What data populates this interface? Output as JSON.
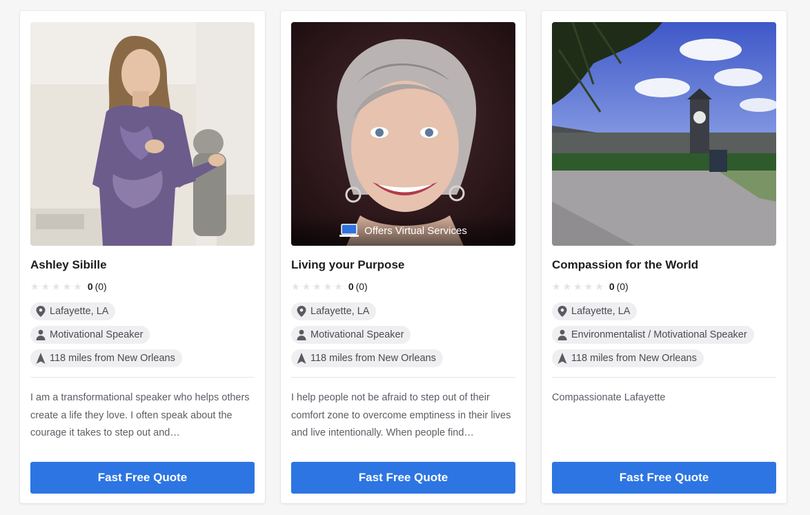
{
  "cards": [
    {
      "name": "Ashley Sibille",
      "rating_value": "0",
      "rating_count": "(0)",
      "location": "Lafayette, LA",
      "category": "Motivational Speaker",
      "distance": "118 miles from New Orleans",
      "description": "I am a transformational speaker who helps others create a life they love. I often speak about the courage it takes to step out and…",
      "button": "Fast Free Quote"
    },
    {
      "name": "Living your Purpose",
      "rating_value": "0",
      "rating_count": "(0)",
      "location": "Lafayette, LA",
      "category": "Motivational Speaker",
      "distance": "118 miles from New Orleans",
      "description": "I help people not be afraid to step out of their comfort zone to overcome emptiness in their lives and live intentionally. When people find…",
      "virtual_badge": "Offers Virtual Services",
      "button": "Fast Free Quote"
    },
    {
      "name": "Compassion for the World",
      "rating_value": "0",
      "rating_count": "(0)",
      "location": "Lafayette, LA",
      "category": "Environmentalist / Motivational Speaker",
      "distance": "118 miles from New Orleans",
      "description": "Compassionate Lafayette",
      "button": "Fast Free Quote"
    }
  ],
  "colors": {
    "button": "#2d75e2",
    "chip_bg": "#efeff1",
    "star_empty": "#e3e3e6"
  },
  "icons": [
    "map-pin-icon",
    "person-icon",
    "navigation-arrow-icon",
    "laptop-icon",
    "star-icon"
  ]
}
